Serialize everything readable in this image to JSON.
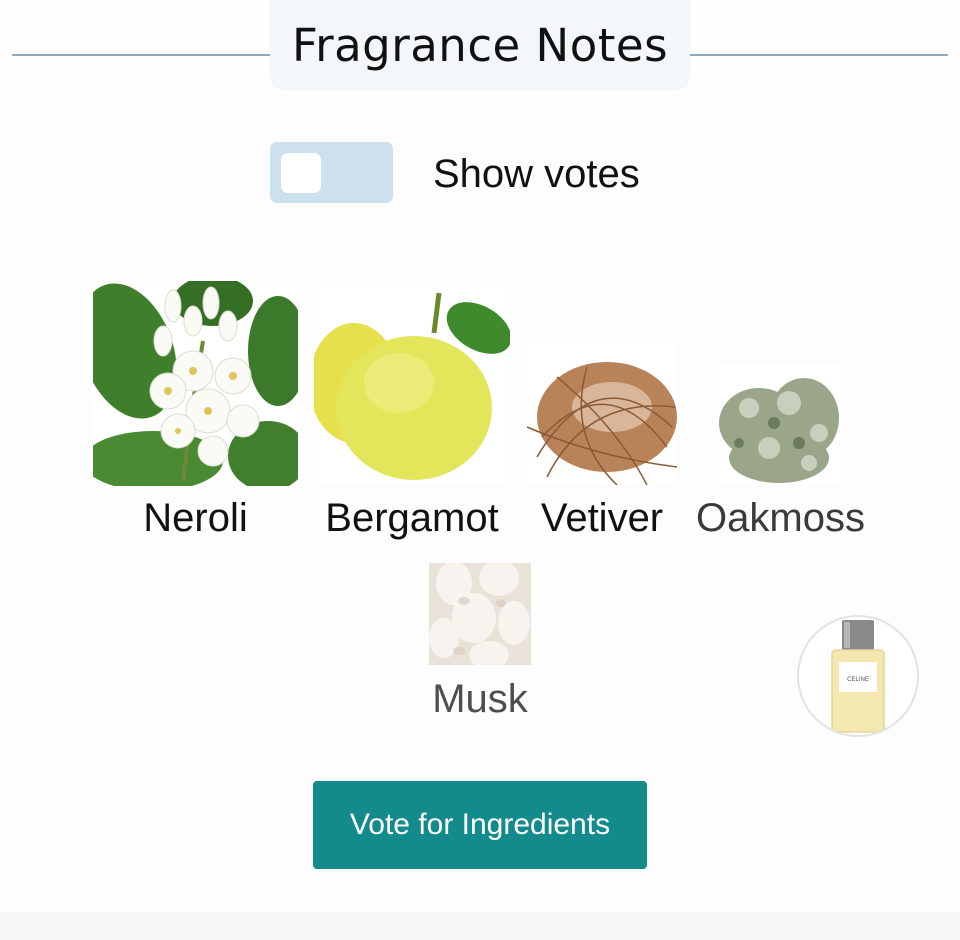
{
  "section": {
    "title": "Fragrance Notes"
  },
  "toggle": {
    "label": "Show votes",
    "checked": false,
    "track_color": "#cde0ee",
    "knob_color": "#ffffff"
  },
  "notes": [
    {
      "name": "Neroli",
      "icon": "neroli-flower-image"
    },
    {
      "name": "Bergamot",
      "icon": "bergamot-fruit-image"
    },
    {
      "name": "Vetiver",
      "icon": "vetiver-root-image"
    },
    {
      "name": "Oakmoss",
      "icon": "oakmoss-lichen-image"
    },
    {
      "name": "Musk",
      "icon": "musk-cotton-image"
    }
  ],
  "perfume_thumbnail": {
    "icon": "perfume-bottle-image",
    "brand_text": "CELINE"
  },
  "actions": {
    "vote_label": "Vote for Ingredients",
    "vote_color": "#138a8c"
  },
  "colors": {
    "divider": "#8ea9bd",
    "title_bg": "#f4f7fa"
  }
}
